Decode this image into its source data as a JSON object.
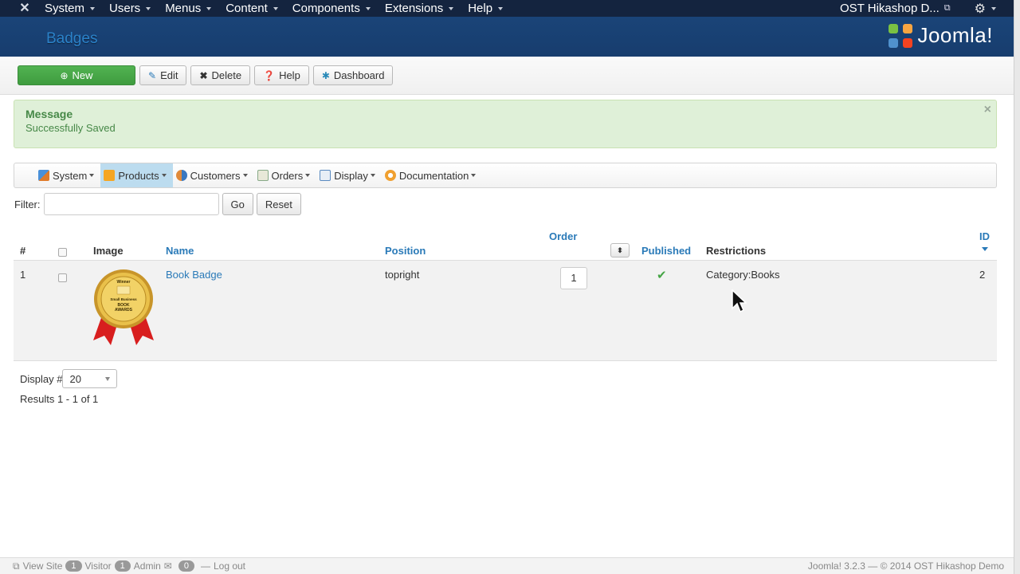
{
  "topnav": {
    "menus": [
      {
        "label": "System"
      },
      {
        "label": "Users"
      },
      {
        "label": "Menus"
      },
      {
        "label": "Content"
      },
      {
        "label": "Components"
      },
      {
        "label": "Extensions"
      },
      {
        "label": "Help"
      }
    ],
    "site_name": "OST Hikashop D...",
    "logo_icon": "joomla-icon",
    "gear_icon": "gear-icon"
  },
  "header": {
    "title": "Badges",
    "brand": "Joomla!"
  },
  "toolbar": {
    "new_label": "New",
    "edit_label": "Edit",
    "delete_label": "Delete",
    "help_label": "Help",
    "dashboard_label": "Dashboard"
  },
  "message": {
    "heading": "Message",
    "text": "Successfully Saved",
    "close": "×"
  },
  "submenu": {
    "items": [
      {
        "label": "System",
        "icon": "tools-icon",
        "active": false
      },
      {
        "label": "Products",
        "icon": "box-icon",
        "active": true
      },
      {
        "label": "Customers",
        "icon": "users-icon",
        "active": false
      },
      {
        "label": "Orders",
        "icon": "orders-icon",
        "active": false
      },
      {
        "label": "Display",
        "icon": "display-icon",
        "active": false
      },
      {
        "label": "Documentation",
        "icon": "documentation-icon",
        "active": false
      }
    ]
  },
  "filter": {
    "label": "Filter:",
    "value": "",
    "go_label": "Go",
    "reset_label": "Reset"
  },
  "table": {
    "headers": {
      "num": "#",
      "image": "Image",
      "name": "Name",
      "position": "Position",
      "order": "Order",
      "published": "Published",
      "restrictions": "Restrictions",
      "id": "ID"
    },
    "rows": [
      {
        "num": "1",
        "image_alt": "Winner Small Business BOOK AWARDS",
        "name": "Book Badge",
        "position": "topright",
        "order": "1",
        "published": true,
        "restrictions": "Category:Books",
        "id": "2"
      }
    ]
  },
  "badge_text": {
    "line1": "Winner",
    "line2": "Small Business",
    "line3": "BOOK",
    "line4": "AWARDS"
  },
  "pagination": {
    "display_label": "Display #",
    "display_value": "20",
    "results": "Results 1 - 1 of 1"
  },
  "footer": {
    "view_site": "View Site",
    "visitor_count": "1",
    "visitor_label": "Visitor",
    "admin_count": "1",
    "admin_label": "Admin",
    "messages_count": "0",
    "logout_label": "Log out",
    "copyright": "Joomla! 3.2.3  —  © 2014 OST Hikashop Demo"
  },
  "colors": {
    "nav_bg": "#14243f",
    "header_bg": "#1a4478",
    "accent": "#2a7ab8",
    "success_bg": "#dff0d8",
    "success_text": "#468847",
    "new_button": "#4cae4c"
  }
}
